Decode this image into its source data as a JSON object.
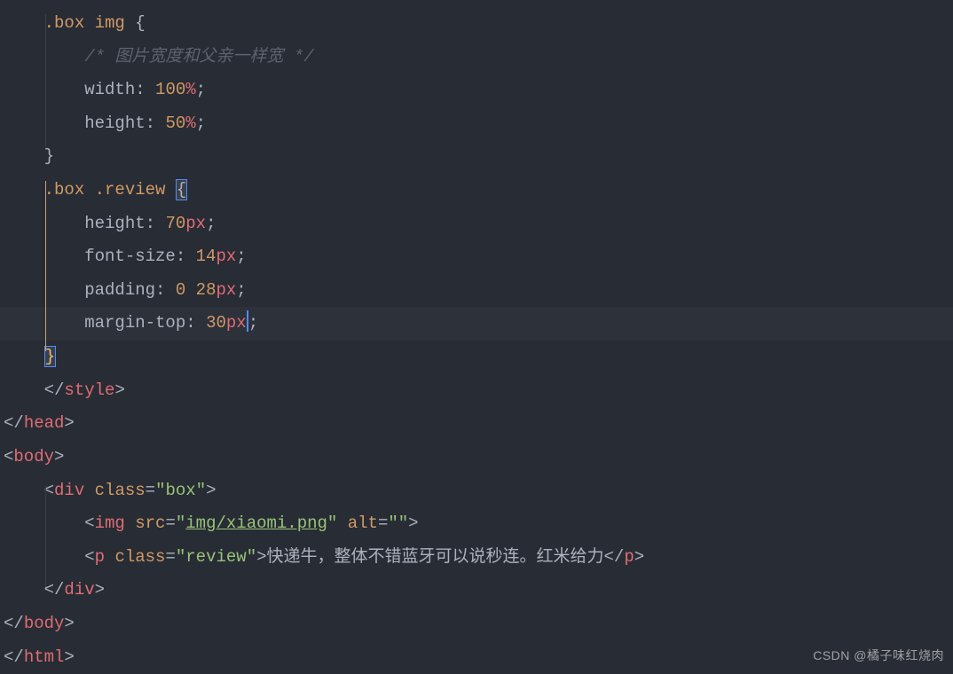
{
  "code": {
    "l1": {
      "sel1": ".box",
      "sel2": "img",
      "brace": "{"
    },
    "l2": {
      "comment": "/* 图片宽度和父亲一样宽 */"
    },
    "l3": {
      "prop": "width",
      "colon": ": ",
      "val": "100",
      "unit": "%",
      "semi": ";"
    },
    "l4": {
      "prop": "height",
      "colon": ": ",
      "val": "50",
      "unit": "%",
      "semi": ";"
    },
    "l5": {
      "brace": "}"
    },
    "l6": {
      "sel1": ".box",
      "sel2": ".review",
      "brace": "{"
    },
    "l7": {
      "prop": "height",
      "colon": ": ",
      "val": "70",
      "unit": "px",
      "semi": ";"
    },
    "l8": {
      "prop": "font-size",
      "colon": ": ",
      "val": "14",
      "unit": "px",
      "semi": ";"
    },
    "l9": {
      "prop": "padding",
      "colon": ": ",
      "val1": "0",
      "sp": " ",
      "val2": "28",
      "unit": "px",
      "semi": ";"
    },
    "l10": {
      "prop": "margin-top",
      "colon": ": ",
      "val": "30",
      "unit": "px",
      "semi": ";"
    },
    "l11": {
      "brace": "}"
    },
    "l12": {
      "lt": "</",
      "tag": "style",
      "gt": ">"
    },
    "l13": {
      "lt": "</",
      "tag": "head",
      "gt": ">"
    },
    "l14": {
      "lt": "<",
      "tag": "body",
      "gt": ">"
    },
    "l15": {
      "lt": "<",
      "tag": "div",
      "sp": " ",
      "attr": "class",
      "eq": "=",
      "q1": "\"",
      "val": "box",
      "q2": "\"",
      "gt": ">"
    },
    "l16": {
      "lt": "<",
      "tag": "img",
      "sp": " ",
      "attr1": "src",
      "eq1": "=",
      "q1a": "\"",
      "val1": "img/xiaomi.png",
      "q1b": "\"",
      "sp2": " ",
      "attr2": "alt",
      "eq2": "=",
      "q2a": "\"",
      "val2": "",
      "q2b": "\"",
      "gt": ">"
    },
    "l17": {
      "lt": "<",
      "tag": "p",
      "sp": " ",
      "attr": "class",
      "eq": "=",
      "q1": "\"",
      "val": "review",
      "q2": "\"",
      "gt": ">",
      "text": "快递牛，整体不错蓝牙可以说秒连。红米给力",
      "lt2": "</",
      "tag2": "p",
      "gt2": ">"
    },
    "l18": {
      "lt": "</",
      "tag": "div",
      "gt": ">"
    },
    "l19": {
      "lt": "</",
      "tag": "body",
      "gt": ">"
    },
    "l20": {
      "lt": "</",
      "tag": "html",
      "gt": ">"
    }
  },
  "watermark": "CSDN @橘子味红烧肉"
}
